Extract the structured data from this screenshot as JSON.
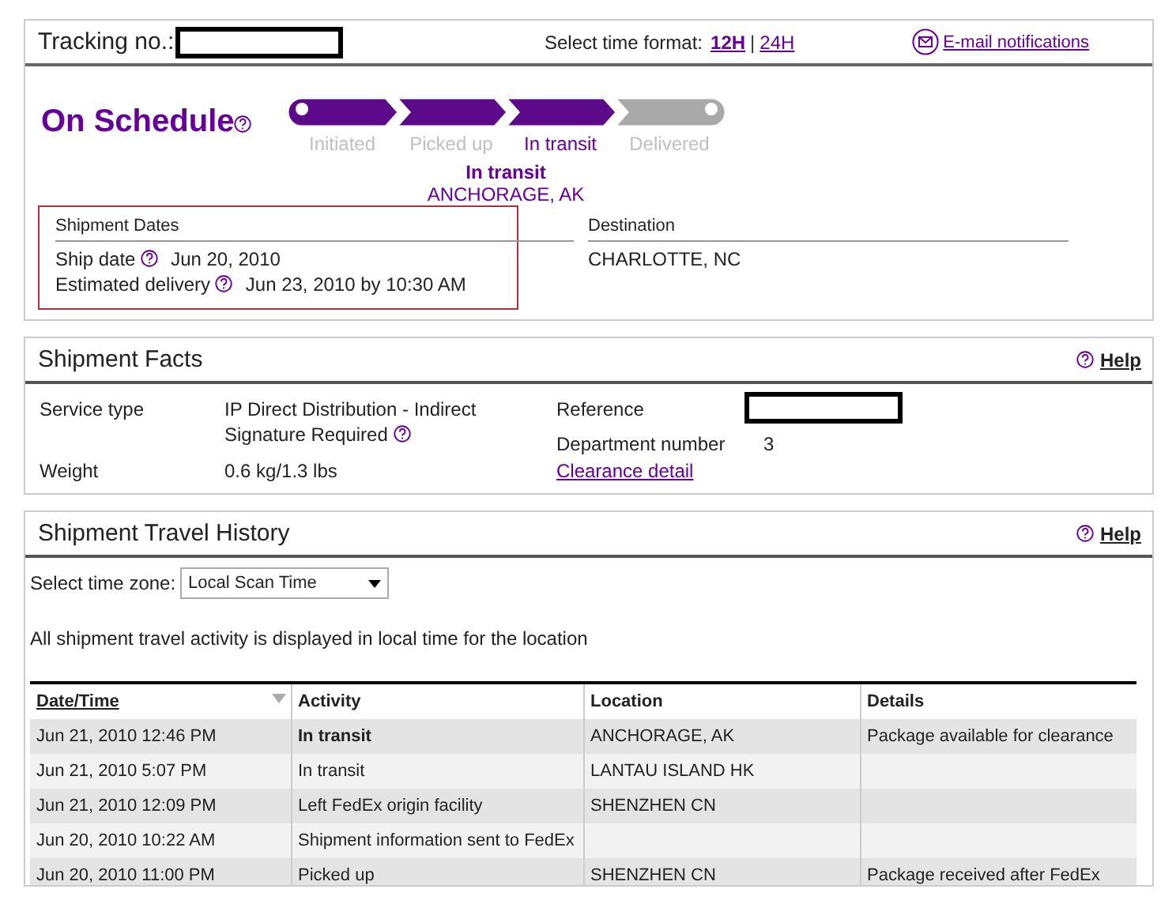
{
  "tracking": {
    "label": "Tracking no.:",
    "time_format_label": "Select time format:",
    "time_formats": [
      {
        "label": "12H",
        "selected": true
      },
      {
        "label": "24H",
        "selected": false
      }
    ],
    "time_format_separator": "|",
    "email_link": "E-mail notifications"
  },
  "status": {
    "title": "On Schedule",
    "steps": [
      {
        "label": "Initiated",
        "done": true,
        "selected": false
      },
      {
        "label": "Picked up",
        "done": true,
        "selected": false
      },
      {
        "label": "In transit",
        "done": true,
        "selected": true
      },
      {
        "label": "Delivered",
        "done": false,
        "selected": false
      }
    ],
    "current_activity": "In transit",
    "current_location": "ANCHORAGE, AK"
  },
  "shipment_dates": {
    "heading": "Shipment Dates",
    "ship_date_label": "Ship date",
    "ship_date": "Jun 20, 2010",
    "delivery_label": "Estimated delivery",
    "delivery": "Jun 23, 2010 by 10:30 AM"
  },
  "destination": {
    "heading": "Destination",
    "value": "CHARLOTTE, NC"
  },
  "facts": {
    "title": "Shipment Facts",
    "help": "Help",
    "service_label": "Service type",
    "service_value_lines": [
      "IP Direct Distribution - Indirect",
      "Signature Required"
    ],
    "weight_label": "Weight",
    "weight_value": "0.6 kg/1.3 lbs",
    "reference_label": "Reference",
    "department_label": "Department number",
    "department_value": "3",
    "clearance_link": "Clearance detail"
  },
  "history": {
    "title": "Shipment Travel History",
    "help": "Help",
    "timezone_label": "Select time zone:",
    "timezone_value": "Local Scan Time",
    "note": "All shipment travel activity is displayed in local time for the location",
    "columns": [
      "Date/Time",
      "Activity",
      "Location",
      "Details"
    ],
    "rows": [
      {
        "datetime": "Jun 21, 2010 12:46 PM",
        "activity": "In transit",
        "location": "ANCHORAGE, AK",
        "details": "Package available for clearance",
        "latest": true
      },
      {
        "datetime": "Jun 21, 2010 5:07 PM",
        "activity": "In transit",
        "location": "LANTAU ISLAND HK",
        "latest": false
      },
      {
        "datetime": "Jun 21, 2010 12:09 PM",
        "activity": "Left FedEx origin facility",
        "location": "SHENZHEN CN",
        "latest": false
      },
      {
        "datetime": "Jun 20, 2010 10:22 AM",
        "activity": "Shipment information sent to FedEx",
        "latest": false
      },
      {
        "datetime": "Jun 20, 2010 11:00 PM",
        "activity": "Picked up",
        "location": "SHENZHEN CN",
        "details": "Package received after FedEx",
        "latest": false
      }
    ]
  }
}
